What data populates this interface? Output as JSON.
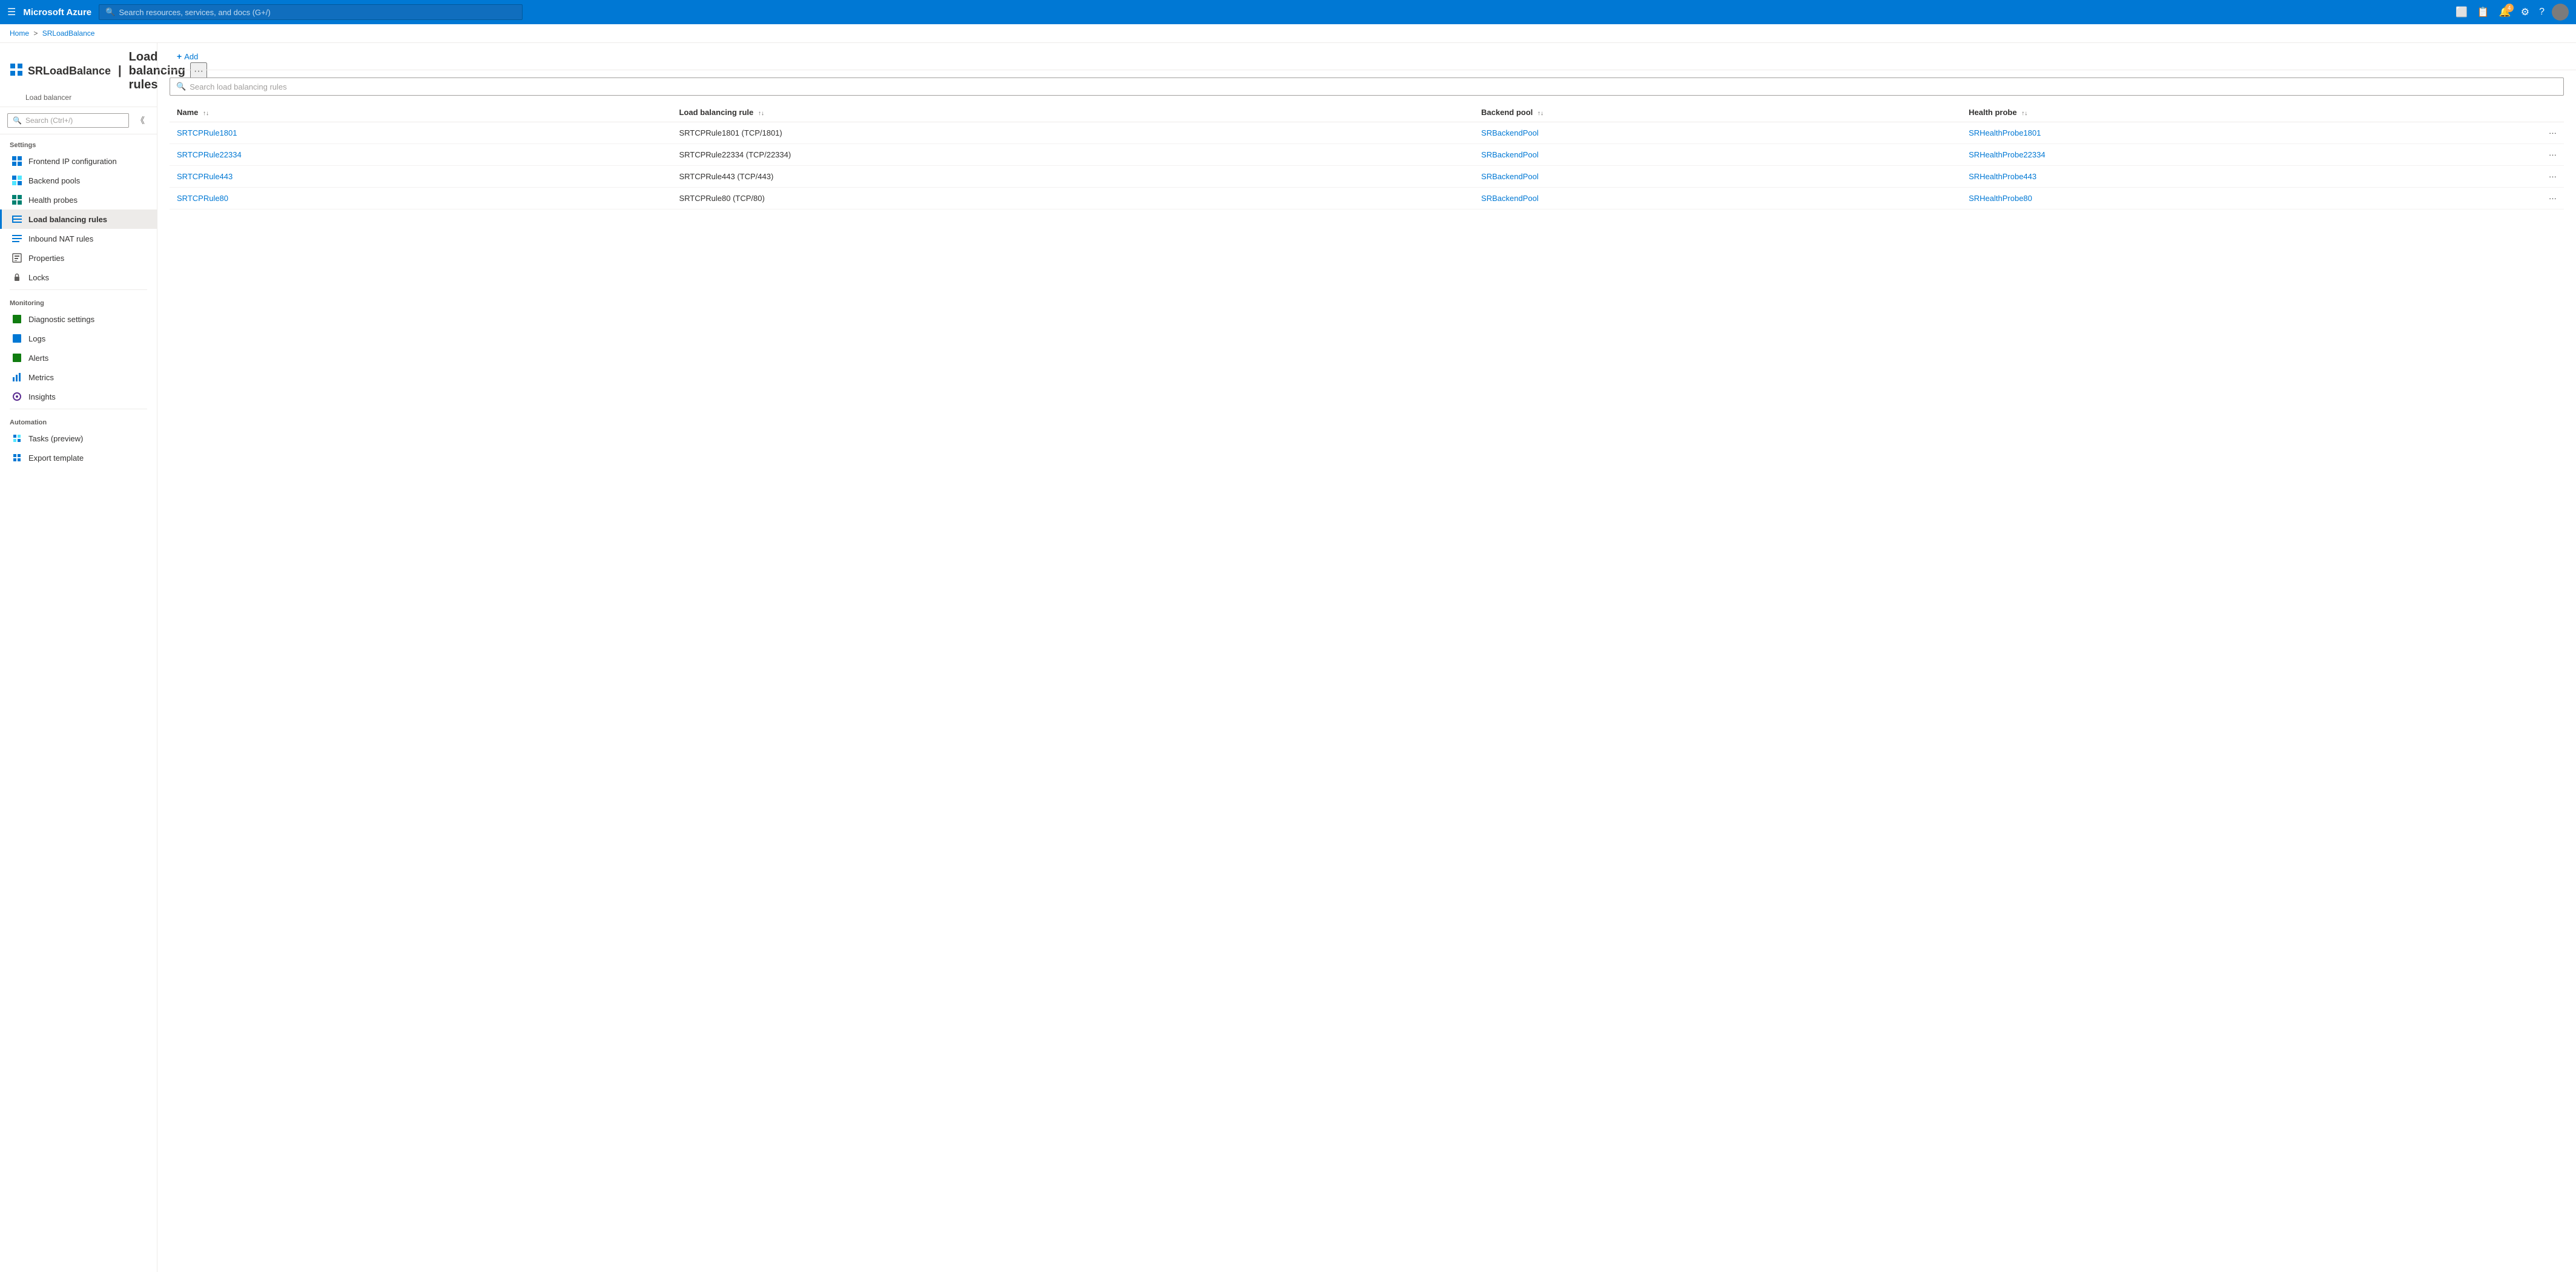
{
  "navbar": {
    "hamburger": "☰",
    "brand": "Microsoft Azure",
    "search_placeholder": "Search resources, services, and docs (G+/)",
    "notification_count": "4",
    "icons": [
      "cloud-shell",
      "feedback",
      "notifications",
      "settings",
      "help",
      "account"
    ]
  },
  "breadcrumb": {
    "home": "Home",
    "separator1": ">",
    "resource": "SRLoadBalance"
  },
  "resource": {
    "name": "SRLoadBalance",
    "separator": "|",
    "page_title": "Load balancing rules",
    "type": "Load balancer",
    "more_label": "···"
  },
  "left_search": {
    "placeholder": "Search (Ctrl+/)"
  },
  "sidebar": {
    "settings_label": "Settings",
    "items_settings": [
      {
        "id": "frontend-ip",
        "label": "Frontend IP configuration",
        "icon": "grid"
      },
      {
        "id": "backend-pools",
        "label": "Backend pools",
        "icon": "grid-blue"
      },
      {
        "id": "health-probes",
        "label": "Health probes",
        "icon": "grid-teal"
      },
      {
        "id": "load-balancing-rules",
        "label": "Load balancing rules",
        "icon": "list",
        "active": true
      },
      {
        "id": "inbound-nat-rules",
        "label": "Inbound NAT rules",
        "icon": "list-blue"
      },
      {
        "id": "properties",
        "label": "Properties",
        "icon": "properties"
      },
      {
        "id": "locks",
        "label": "Locks",
        "icon": "lock"
      }
    ],
    "monitoring_label": "Monitoring",
    "items_monitoring": [
      {
        "id": "diagnostic-settings",
        "label": "Diagnostic settings",
        "icon": "diagnostic"
      },
      {
        "id": "logs",
        "label": "Logs",
        "icon": "logs"
      },
      {
        "id": "alerts",
        "label": "Alerts",
        "icon": "alerts"
      },
      {
        "id": "metrics",
        "label": "Metrics",
        "icon": "metrics"
      },
      {
        "id": "insights",
        "label": "Insights",
        "icon": "insights"
      }
    ],
    "automation_label": "Automation",
    "items_automation": [
      {
        "id": "tasks-preview",
        "label": "Tasks (preview)",
        "icon": "tasks"
      },
      {
        "id": "export-template",
        "label": "Export template",
        "icon": "export"
      }
    ]
  },
  "toolbar": {
    "add_label": "Add",
    "add_icon": "+"
  },
  "table_search": {
    "placeholder": "Search load balancing rules"
  },
  "table": {
    "columns": [
      {
        "id": "name",
        "label": "Name"
      },
      {
        "id": "load-balancing-rule",
        "label": "Load balancing rule"
      },
      {
        "id": "backend-pool",
        "label": "Backend pool"
      },
      {
        "id": "health-probe",
        "label": "Health probe"
      }
    ],
    "rows": [
      {
        "name": "SRTCPRule1801",
        "load_balancing_rule": "SRTCPRule1801 (TCP/1801)",
        "backend_pool": "SRBackendPool",
        "health_probe": "SRHealthProbe1801"
      },
      {
        "name": "SRTCPRule22334",
        "load_balancing_rule": "SRTCPRule22334 (TCP/22334)",
        "backend_pool": "SRBackendPool",
        "health_probe": "SRHealthProbe22334"
      },
      {
        "name": "SRTCPRule443",
        "load_balancing_rule": "SRTCPRule443 (TCP/443)",
        "backend_pool": "SRBackendPool",
        "health_probe": "SRHealthProbe443"
      },
      {
        "name": "SRTCPRule80",
        "load_balancing_rule": "SRTCPRule80 (TCP/80)",
        "backend_pool": "SRBackendPool",
        "health_probe": "SRHealthProbe80"
      }
    ]
  }
}
